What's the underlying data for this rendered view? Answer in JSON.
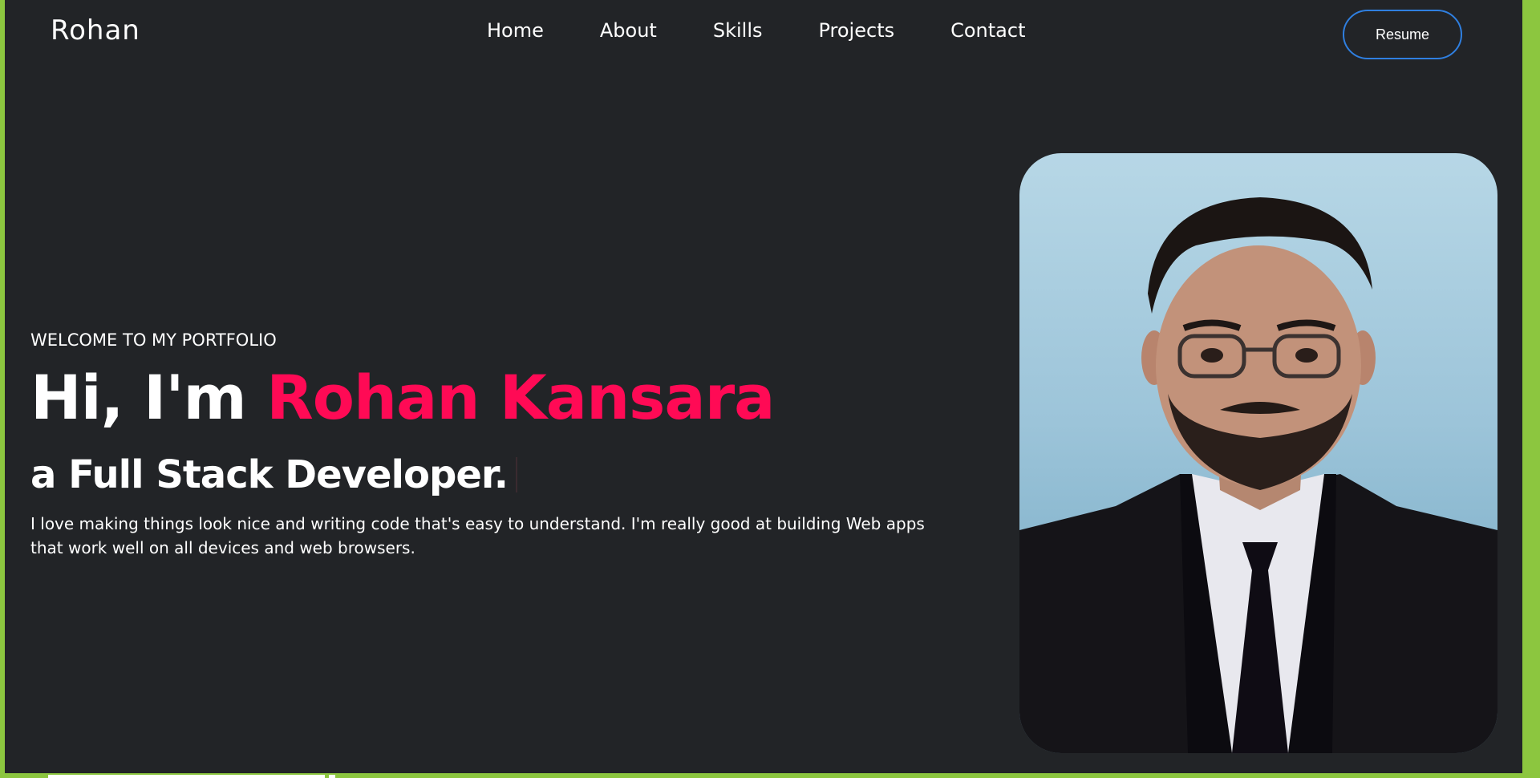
{
  "navbar": {
    "brand": "Rohan",
    "links": [
      "Home",
      "About",
      "Skills",
      "Projects",
      "Contact"
    ],
    "resume_label": "Resume"
  },
  "hero": {
    "welcome": "WELCOME TO MY PORTFOLIO",
    "greeting": "Hi, I'm",
    "name": "Rohan Kansara",
    "role": "a Full Stack Developer.",
    "bio_line1": "I love making things look nice and writing code that's easy to understand. I'm really good at building Web apps",
    "bio_line2": "that work well on all devices and web browsers."
  },
  "colors": {
    "background": "#222427",
    "accent": "#ff0a55",
    "button_border": "#2f7fe0",
    "frame": "#8cc63f"
  },
  "icons": {
    "profile_photo": "profile-photo"
  }
}
